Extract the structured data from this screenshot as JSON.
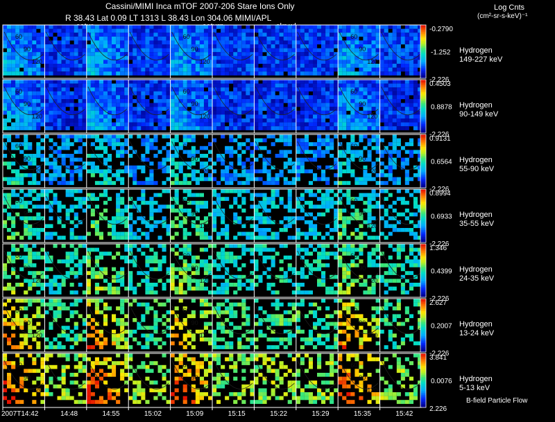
{
  "header": {
    "title": "Cassini/MIMI Inca mTOF  2007-206   Stare    Ions Only",
    "coords": "R        38.43 Lat 0.09 LT 1313 L        38.43 Lon       304.06   MIMI/APL",
    "marker_saturn_left": "satur",
    "marker_saturn": "saturn",
    "marker_skr": "skr-wl",
    "units_line1": "Log Cnts",
    "units_line2": "(cm²-sr-s-keV)⁻¹"
  },
  "footer": {
    "bfield_label": "B-field Particle Flow"
  },
  "chart_data": {
    "type": "heatmap",
    "title": "Cassini/MIMI Inca mTOF  2007-206   Stare    Ions Only",
    "xlabel": "",
    "x_tick_labels": [
      "2007T14:42",
      "14:48",
      "14:55",
      "15:02",
      "15:09",
      "15:15",
      "15:22",
      "15:29",
      "15:35",
      "15:42"
    ],
    "columns_per_row": 10,
    "colorscale": "rainbow (blue low → red high)",
    "rows": [
      {
        "species": "Hydrogen",
        "energy": "149-227 keV",
        "cbar_max": "-0.2790",
        "cbar_mid": "-1.252",
        "cbar_min": "-2.226",
        "intensity": 0.15
      },
      {
        "species": "Hydrogen",
        "energy": "90-149 keV",
        "cbar_max": "0.4503",
        "cbar_mid": "0.8878",
        "cbar_min": "-2.226",
        "intensity": 0.14
      },
      {
        "species": "Hydrogen",
        "energy": "55-90 keV",
        "cbar_max": "0.9131",
        "cbar_mid": "0.6564",
        "cbar_min": "-2.226",
        "intensity": 0.28
      },
      {
        "species": "Hydrogen",
        "energy": "35-55 keV",
        "cbar_max": "0.8994",
        "cbar_mid": "0.6933",
        "cbar_min": "-2.226",
        "intensity": 0.38
      },
      {
        "species": "Hydrogen",
        "energy": "24-35 keV",
        "cbar_max": "1.346",
        "cbar_mid": "0.4399",
        "cbar_min": "-2.226",
        "intensity": 0.45
      },
      {
        "species": "Hydrogen",
        "energy": "13-24 keV",
        "cbar_max": "2.627",
        "cbar_mid": "0.2007",
        "cbar_min": "-2.226",
        "intensity": 0.52
      },
      {
        "species": "Hydrogen",
        "energy": "5-13 keV",
        "cbar_max": "3.841",
        "cbar_mid": "0.0076",
        "cbar_min": "2.226",
        "intensity": 0.62
      }
    ],
    "contour_labels": [
      "60",
      "90",
      "120"
    ]
  }
}
